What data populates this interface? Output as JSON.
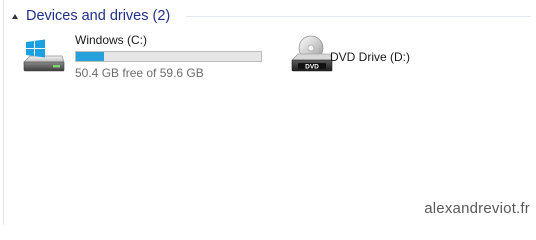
{
  "group": {
    "title": "Devices and drives (2)"
  },
  "drives": [
    {
      "name": "Windows (C:)",
      "space_text": "50.4 GB free of 59.6 GB",
      "used_fraction": 0.154,
      "icon": "hard-drive-windows-icon"
    },
    {
      "name": "DVD Drive (D:)",
      "icon": "dvd-drive-icon",
      "icon_label": "DVD"
    }
  ],
  "watermark": "alexandreviot.fr",
  "colors": {
    "header_text": "#1e3287",
    "bar_fill": "#26a0da",
    "bar_track": "#e6e6e6",
    "windows_logo": "#1ba1e2"
  }
}
